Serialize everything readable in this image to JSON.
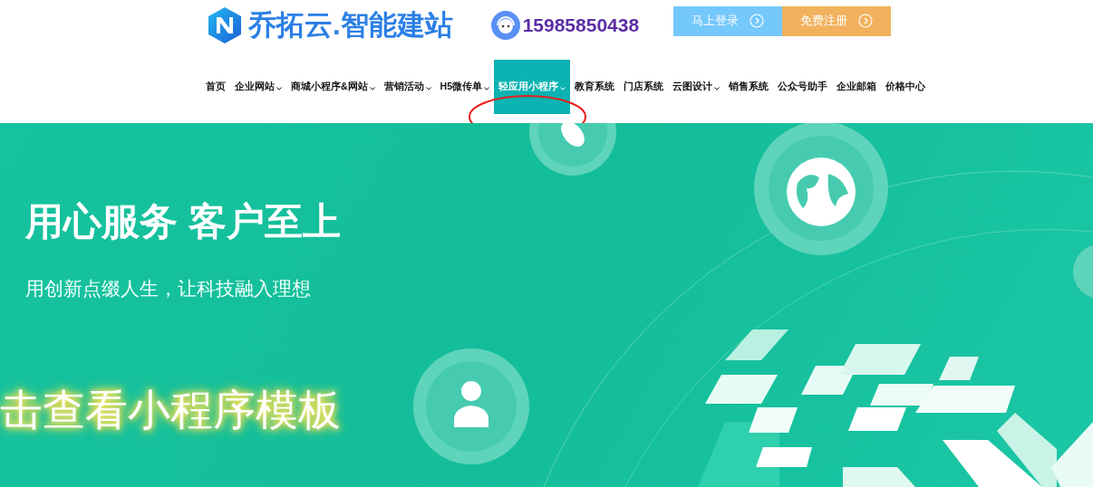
{
  "header": {
    "logo_text": "乔拓云.智能建站",
    "phone": "15985850438",
    "buttons": [
      {
        "label": "马上登录",
        "kind": "login"
      },
      {
        "label": "免费注册",
        "kind": "register"
      }
    ]
  },
  "nav": {
    "items": [
      {
        "label": "首页",
        "dropdown": false,
        "selected": false
      },
      {
        "label": "企业网站",
        "dropdown": true,
        "selected": false
      },
      {
        "label": "商城小程序&网站",
        "dropdown": true,
        "selected": false
      },
      {
        "label": "营销活动",
        "dropdown": true,
        "selected": false
      },
      {
        "label": "H5微传单",
        "dropdown": true,
        "selected": false
      },
      {
        "label": "轻应用小程序",
        "dropdown": true,
        "selected": true
      },
      {
        "label": "教育系统",
        "dropdown": false,
        "selected": false
      },
      {
        "label": "门店系统",
        "dropdown": false,
        "selected": false
      },
      {
        "label": "云图设计",
        "dropdown": true,
        "selected": false
      },
      {
        "label": "销售系统",
        "dropdown": false,
        "selected": false
      },
      {
        "label": "公众号助手",
        "dropdown": false,
        "selected": false
      },
      {
        "label": "企业邮箱",
        "dropdown": false,
        "selected": false
      },
      {
        "label": "价格中心",
        "dropdown": false,
        "selected": false
      }
    ]
  },
  "banner": {
    "title": "用心服务 客户至上",
    "subtitle": "用创新点缀人生，让科技融入理想",
    "cta": "击查看小程序模板"
  }
}
